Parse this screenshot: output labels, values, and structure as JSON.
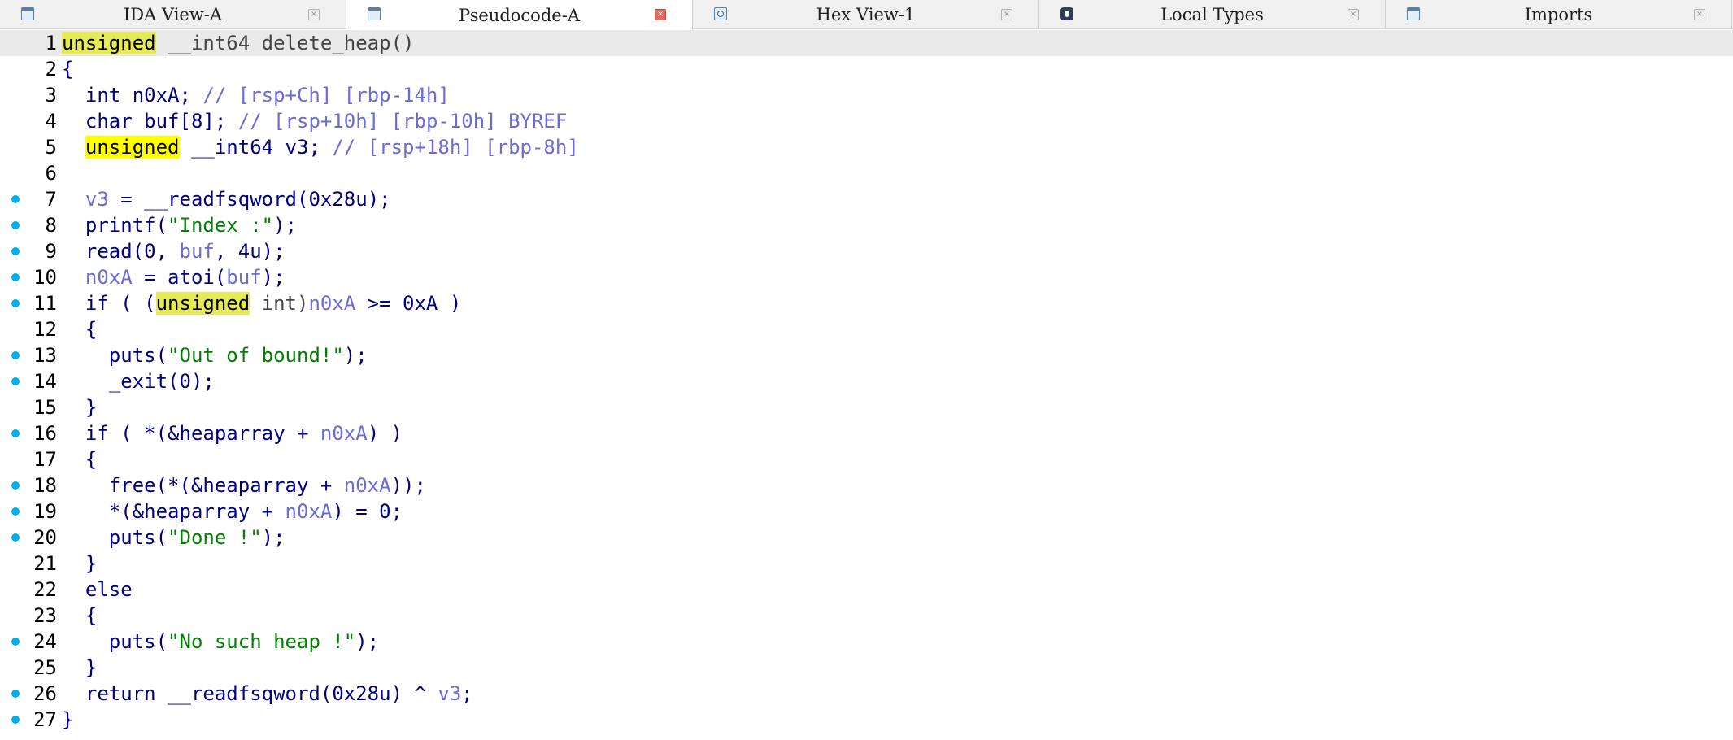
{
  "tabs": [
    {
      "label": "IDA View-A",
      "icon": "ida-view-icon",
      "active": false
    },
    {
      "label": "Pseudocode-A",
      "icon": "pseudocode-icon",
      "active": true
    },
    {
      "label": "Hex View-1",
      "icon": "hex-view-icon",
      "active": false
    },
    {
      "label": "Local Types",
      "icon": "local-types-icon",
      "active": false
    },
    {
      "label": "Imports",
      "icon": "imports-icon",
      "active": false
    }
  ],
  "close_glyph": "×",
  "code": {
    "current_line": 1,
    "breakpoint_dot_color": "#00b2e6",
    "lines": [
      {
        "num": "1",
        "dot": false,
        "segs": [
          [
            "unsigned",
            "hl soft"
          ],
          [
            " __int64 delete_heap()",
            "c-type"
          ]
        ]
      },
      {
        "num": "2",
        "dot": false,
        "segs": [
          [
            "{",
            "c-plain"
          ]
        ]
      },
      {
        "num": "3",
        "dot": false,
        "segs": [
          [
            "  int n0xA; ",
            "c-plain"
          ],
          [
            "// [rsp+Ch] [rbp-14h]",
            "c-cmt"
          ]
        ]
      },
      {
        "num": "4",
        "dot": false,
        "segs": [
          [
            "  char buf[8]; ",
            "c-plain"
          ],
          [
            "// [rsp+10h] [rbp-10h] BYREF",
            "c-cmt"
          ]
        ]
      },
      {
        "num": "5",
        "dot": false,
        "segs": [
          [
            "  ",
            "c-plain"
          ],
          [
            "unsigned",
            "hl"
          ],
          [
            " __int64 v3; ",
            "c-plain"
          ],
          [
            "// [rsp+18h] [rbp-8h]",
            "c-cmt"
          ]
        ]
      },
      {
        "num": "6",
        "dot": false,
        "segs": []
      },
      {
        "num": "7",
        "dot": true,
        "segs": [
          [
            "  ",
            "c-plain"
          ],
          [
            "v3",
            "c-var"
          ],
          [
            " = __readfsqword(0x28u);",
            "c-plain"
          ]
        ]
      },
      {
        "num": "8",
        "dot": true,
        "segs": [
          [
            "  printf(",
            "c-plain"
          ],
          [
            "\"Index :\"",
            "c-str"
          ],
          [
            ");",
            "c-plain"
          ]
        ]
      },
      {
        "num": "9",
        "dot": true,
        "segs": [
          [
            "  read(0, ",
            "c-plain"
          ],
          [
            "buf",
            "c-var"
          ],
          [
            ", 4u);",
            "c-plain"
          ]
        ]
      },
      {
        "num": "10",
        "dot": true,
        "segs": [
          [
            "  ",
            "c-plain"
          ],
          [
            "n0xA",
            "c-var"
          ],
          [
            " = atoi(",
            "c-plain"
          ],
          [
            "buf",
            "c-var"
          ],
          [
            ");",
            "c-plain"
          ]
        ]
      },
      {
        "num": "11",
        "dot": true,
        "segs": [
          [
            "  if ( (",
            "c-plain"
          ],
          [
            "unsigned",
            "hl soft"
          ],
          [
            " int)",
            "c-type"
          ],
          [
            "n0xA",
            "c-var"
          ],
          [
            " >= 0xA )",
            "c-plain"
          ]
        ]
      },
      {
        "num": "12",
        "dot": false,
        "segs": [
          [
            "  {",
            "c-plain"
          ]
        ]
      },
      {
        "num": "13",
        "dot": true,
        "segs": [
          [
            "    puts(",
            "c-plain"
          ],
          [
            "\"Out of bound!\"",
            "c-str"
          ],
          [
            ");",
            "c-plain"
          ]
        ]
      },
      {
        "num": "14",
        "dot": true,
        "segs": [
          [
            "    _exit(0);",
            "c-plain"
          ]
        ]
      },
      {
        "num": "15",
        "dot": false,
        "segs": [
          [
            "  }",
            "c-plain"
          ]
        ]
      },
      {
        "num": "16",
        "dot": true,
        "segs": [
          [
            "  if ( *(&heaparray + ",
            "c-plain"
          ],
          [
            "n0xA",
            "c-var"
          ],
          [
            ") )",
            "c-plain"
          ]
        ]
      },
      {
        "num": "17",
        "dot": false,
        "segs": [
          [
            "  {",
            "c-plain"
          ]
        ]
      },
      {
        "num": "18",
        "dot": true,
        "segs": [
          [
            "    free(*(&heaparray + ",
            "c-plain"
          ],
          [
            "n0xA",
            "c-var"
          ],
          [
            "));",
            "c-plain"
          ]
        ]
      },
      {
        "num": "19",
        "dot": true,
        "segs": [
          [
            "    *(&heaparray + ",
            "c-plain"
          ],
          [
            "n0xA",
            "c-var"
          ],
          [
            ") = 0;",
            "c-plain"
          ]
        ]
      },
      {
        "num": "20",
        "dot": true,
        "segs": [
          [
            "    puts(",
            "c-plain"
          ],
          [
            "\"Done !\"",
            "c-str"
          ],
          [
            ");",
            "c-plain"
          ]
        ]
      },
      {
        "num": "21",
        "dot": false,
        "segs": [
          [
            "  }",
            "c-plain"
          ]
        ]
      },
      {
        "num": "22",
        "dot": false,
        "segs": [
          [
            "  else",
            "c-plain"
          ]
        ]
      },
      {
        "num": "23",
        "dot": false,
        "segs": [
          [
            "  {",
            "c-plain"
          ]
        ]
      },
      {
        "num": "24",
        "dot": true,
        "segs": [
          [
            "    puts(",
            "c-plain"
          ],
          [
            "\"No such heap !\"",
            "c-str"
          ],
          [
            ");",
            "c-plain"
          ]
        ]
      },
      {
        "num": "25",
        "dot": false,
        "segs": [
          [
            "  }",
            "c-plain"
          ]
        ]
      },
      {
        "num": "26",
        "dot": true,
        "segs": [
          [
            "  return __readfsqword(0x28u) ^ ",
            "c-plain"
          ],
          [
            "v3",
            "c-var"
          ],
          [
            ";",
            "c-plain"
          ]
        ]
      },
      {
        "num": "27",
        "dot": true,
        "segs": [
          [
            "}",
            "c-plain"
          ]
        ]
      }
    ]
  }
}
